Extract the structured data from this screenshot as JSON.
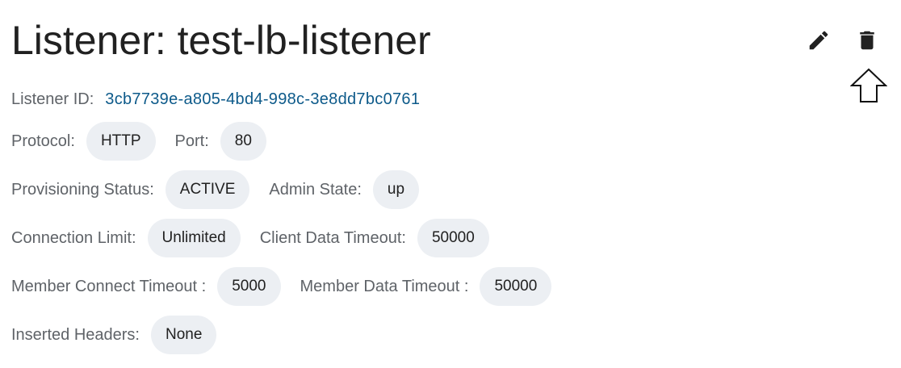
{
  "header": {
    "title": "Listener: test-lb-listener"
  },
  "toolbar": {
    "edit_icon": "pencil-icon",
    "delete_icon": "trash-icon",
    "cursor_icon": "arrow-up-cursor"
  },
  "details": {
    "listener_id": {
      "label": "Listener ID:",
      "value": "3cb7739e-a805-4bd4-998c-3e8dd7bc0761"
    },
    "protocol": {
      "label": "Protocol:",
      "value": "HTTP"
    },
    "port": {
      "label": "Port:",
      "value": "80"
    },
    "provisioning_status": {
      "label": "Provisioning Status:",
      "value": "ACTIVE"
    },
    "admin_state": {
      "label": "Admin State:",
      "value": "up"
    },
    "connection_limit": {
      "label": "Connection Limit:",
      "value": "Unlimited"
    },
    "client_data_timeout": {
      "label": "Client Data Timeout:",
      "value": "50000"
    },
    "member_connect_timeout": {
      "label": "Member Connect Timeout :",
      "value": "5000"
    },
    "member_data_timeout": {
      "label": "Member Data Timeout :",
      "value": "50000"
    },
    "inserted_headers": {
      "label": "Inserted Headers:",
      "value": "None"
    }
  },
  "colors": {
    "link": "#0d5a8a",
    "chip_bg": "#eceff3",
    "label": "#5f6368",
    "title": "#212121"
  }
}
